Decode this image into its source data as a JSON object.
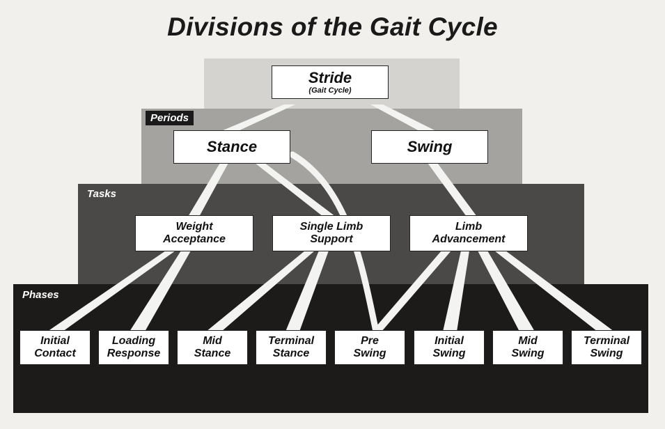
{
  "title": "Divisions of the Gait Cycle",
  "stride": {
    "label": "Stride",
    "sublabel": "(Gait Cycle)"
  },
  "bands": {
    "periods": "Periods",
    "tasks": "Tasks",
    "phases": "Phases"
  },
  "periods": [
    "Stance",
    "Swing"
  ],
  "tasks": [
    [
      "Weight",
      "Acceptance"
    ],
    [
      "Single Limb",
      "Support"
    ],
    [
      "Limb",
      "Advancement"
    ]
  ],
  "phases": [
    [
      "Initial",
      "Contact"
    ],
    [
      "Loading",
      "Response"
    ],
    [
      "Mid",
      "Stance"
    ],
    [
      "Terminal",
      "Stance"
    ],
    [
      "Pre",
      "Swing"
    ],
    [
      "Initial",
      "Swing"
    ],
    [
      "Mid",
      "Swing"
    ],
    [
      "Terminal",
      "Swing"
    ]
  ],
  "colors": {
    "background": "#f1f0ec",
    "stride_band": "#d4d3d0",
    "periods_band": "#a4a3a0",
    "tasks_band": "#4a4947",
    "phases_band": "#1c1b1a",
    "connector": "#f3f3f1"
  }
}
